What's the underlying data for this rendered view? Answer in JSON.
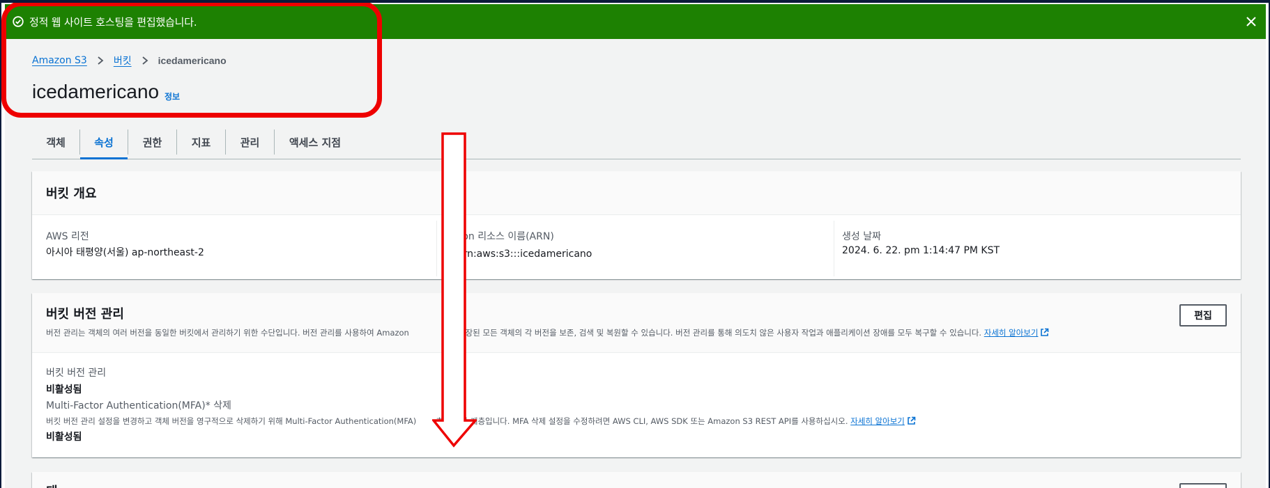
{
  "flash": {
    "message": "정적 웹 사이트 호스팅을 편집했습니다.",
    "color": "#1d8102"
  },
  "breadcrumb": {
    "items": [
      "Amazon S3",
      "버킷",
      "icedamericano"
    ]
  },
  "page": {
    "title": "icedamericano",
    "info_link": "정보"
  },
  "tabs": [
    {
      "label": "객체",
      "active": false
    },
    {
      "label": "속성",
      "active": true
    },
    {
      "label": "권한",
      "active": false
    },
    {
      "label": "지표",
      "active": false
    },
    {
      "label": "관리",
      "active": false
    },
    {
      "label": "액세스 지점",
      "active": false
    }
  ],
  "overview": {
    "title": "버킷 개요",
    "region_label": "AWS 리전",
    "region_value": "아시아 태평양(서울) ap-northeast-2",
    "arn_label": "zon 리소스 이름(ARN)",
    "arn_value": "arn:aws:s3:::icedamericano",
    "created_label": "생성 날짜",
    "created_value": "2024. 6. 22. pm 1:14:47 PM KST"
  },
  "versioning": {
    "title": "버킷 버전 관리",
    "edit_button": "편집",
    "description": "버전 관리는 객체의 여러 버전을 동일한 버킷에서 관리하기 위한 수단입니다. 버전 관리를 사용하여 Amazon",
    "description_rest": "에 저장된 모든 객체의 각 버전을 보존, 검색 및 복원할 수 있습니다. 버전 관리를 통해 의도치 않은 사용자 작업과 애플리케이션 장애를 모두 복구할 수 있습니다.",
    "learn_more": "자세히 알아보기",
    "status_label": "버킷 버전 관리",
    "status_value": "비활성됨",
    "mfa_label": "Multi-Factor Authentication(MFA)* 삭제",
    "mfa_desc": "버킷 버전 관리 설정을 변경하고 객체 버전을 영구적으로 삭제하기 위해 Multi-Factor Authentication(MFA)",
    "mfa_desc_rest": "추가 보안 계층입니다. MFA 삭제 설정을 수정하려면 AWS CLI, AWS SDK 또는 Amazon S3 REST API를 사용하십시오.",
    "mfa_learn_more": "자세히 알아보기",
    "mfa_value": "비활성됨"
  },
  "next_card": {
    "title_partial": "태"
  },
  "colors": {
    "accent": "#0972d3",
    "annotation": "#ee0000"
  }
}
